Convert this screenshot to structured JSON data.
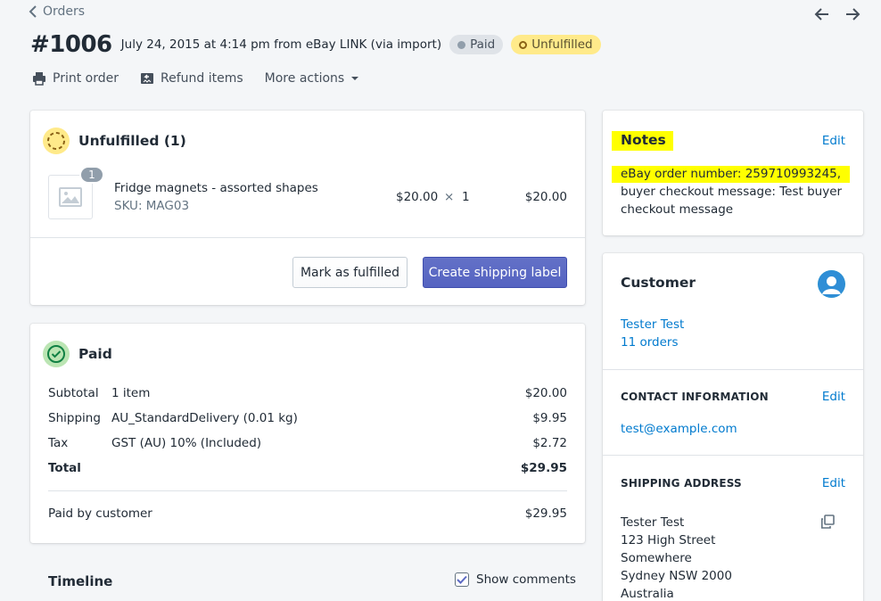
{
  "nav": {
    "back_label": "Orders"
  },
  "order": {
    "number": "#1006",
    "meta": "July 24, 2015 at 4:14 pm from eBay LINK (via import)",
    "badge_paid": "Paid",
    "badge_unfulfilled": "Unfulfilled"
  },
  "actions": {
    "print": "Print order",
    "refund": "Refund items",
    "more": "More actions"
  },
  "unfulfilled": {
    "title": "Unfulfilled (1)",
    "item": {
      "qty_badge": "1",
      "name": "Fridge magnets - assorted shapes",
      "sku": "SKU: MAG03",
      "price": "$20.00",
      "times": "×",
      "qty": "1",
      "total": "$20.00"
    },
    "mark_button": "Mark as fulfilled",
    "create_button": "Create shipping label"
  },
  "paid": {
    "title": "Paid",
    "rows": [
      {
        "label": "Subtotal",
        "desc": "1 item",
        "value": "$20.00"
      },
      {
        "label": "Shipping",
        "desc": "AU_StandardDelivery (0.01 kg)",
        "value": "$9.95"
      },
      {
        "label": "Tax",
        "desc": "GST (AU) 10% (Included)",
        "value": "$2.72"
      }
    ],
    "total_label": "Total",
    "total_value": "$29.95",
    "paid_by_label": "Paid by customer",
    "paid_by_value": "$29.95"
  },
  "timeline": {
    "title": "Timeline",
    "show_comments": "Show comments"
  },
  "notes": {
    "title": "Notes",
    "edit": "Edit",
    "highlight": "eBay order number: 259710993245,",
    "line2": "buyer checkout message: Test buyer",
    "line3": "checkout message"
  },
  "customer": {
    "title": "Customer",
    "name": "Tester Test",
    "orders": "11 orders",
    "contact_title": "CONTACT INFORMATION",
    "contact_edit": "Edit",
    "email": "test@example.com",
    "shipping_title": "SHIPPING ADDRESS",
    "shipping_edit": "Edit",
    "address": [
      "Tester Test",
      "123 High Street",
      "Somewhere",
      "Sydney NSW 2000",
      "Australia"
    ]
  },
  "colors": {
    "accent": "#5c6ac4",
    "link": "#007ace",
    "highlight": "#ffff00",
    "unfulfilled_badge": "#ffea8a",
    "paid_icon": "#bbe5b3"
  }
}
